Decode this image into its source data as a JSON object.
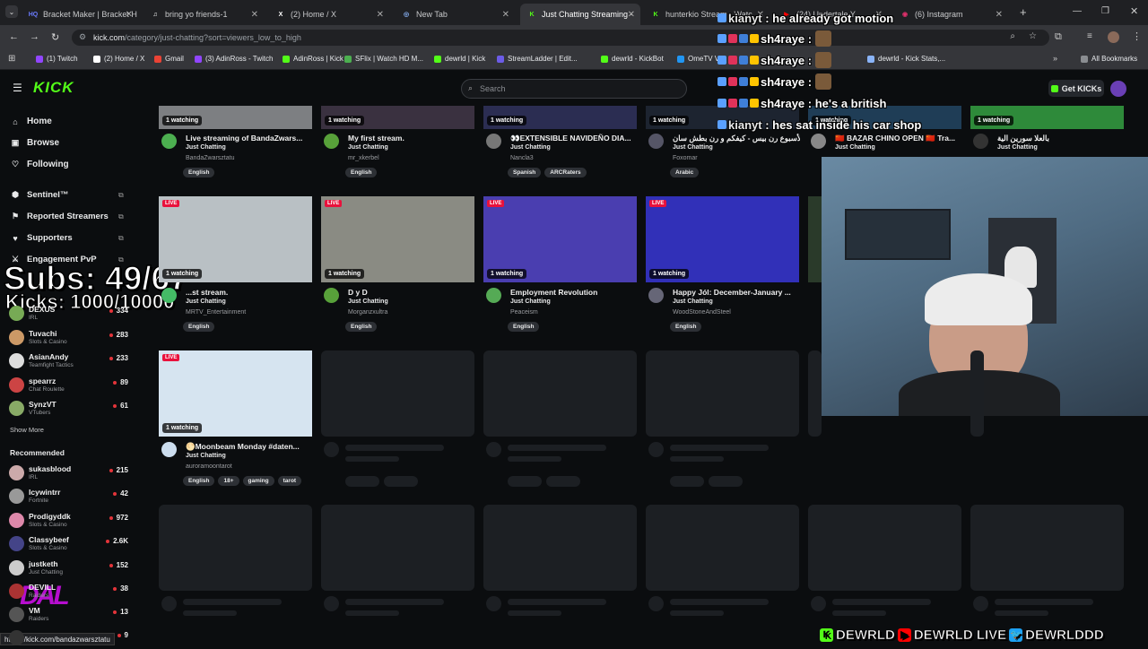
{
  "browser": {
    "tabs": [
      {
        "label": "Bracket Maker | Bracket H",
        "icon": "HQ",
        "color": "#6b7bff"
      },
      {
        "label": "bring yo friends-1",
        "icon": "♫",
        "color": "#ffffff"
      },
      {
        "label": "(2) Home / X",
        "icon": "X",
        "color": "#ffffff"
      },
      {
        "label": "New Tab",
        "icon": "◎",
        "color": "#8ab4f8"
      },
      {
        "label": "Just Chatting Streaming -",
        "icon": "K",
        "color": "#53fc18"
      },
      {
        "label": "hunterkio Stream - Watc",
        "icon": "K",
        "color": "#53fc18"
      },
      {
        "label": "(24) Undertale Y",
        "icon": "▶",
        "color": "#ff0000"
      },
      {
        "label": "(6) Instagram",
        "icon": "◉",
        "color": "#e1306c"
      }
    ],
    "url_host": "kick.com",
    "url_path": "/category/just-chatting?sort=viewers_low_to_high",
    "bookmarks": [
      {
        "label": "(1) Twitch",
        "color": "#9146ff"
      },
      {
        "label": "(2) Home / X",
        "color": "#ffffff"
      },
      {
        "label": "Gmail",
        "color": "#ea4335"
      },
      {
        "label": "(3) AdinRoss - Twitch",
        "color": "#9146ff"
      },
      {
        "label": "AdinRoss | Kick",
        "color": "#53fc18"
      },
      {
        "label": "SFlix | Watch HD M...",
        "color": "#4caf50"
      },
      {
        "label": "dewrld | Kick",
        "color": "#53fc18"
      },
      {
        "label": "StreamLadder | Edit...",
        "color": "#6c5ce7"
      },
      {
        "label": "dewrld - KickBot",
        "color": "#53fc18"
      },
      {
        "label": "OmeTV Vi...",
        "color": "#2196f3"
      },
      {
        "label": "dewrld - Kick Stats,...",
        "color": "#8ab4f8"
      }
    ],
    "all_bookmarks": "All Bookmarks",
    "status_url": "https://kick.com/bandazwarsztatu"
  },
  "kick": {
    "logo": "KICK",
    "search_placeholder": "Search",
    "get_kicks": "Get KICKs",
    "nav": [
      {
        "label": "Home",
        "icon": "⌂"
      },
      {
        "label": "Browse",
        "icon": "▣"
      },
      {
        "label": "Following",
        "icon": "♡"
      }
    ],
    "ext_nav": [
      {
        "label": "Sentinel™",
        "icon": "⬢"
      },
      {
        "label": "Reported Streamers",
        "icon": "⚑"
      },
      {
        "label": "Supporters",
        "icon": "♥"
      },
      {
        "label": "Engagement PvP",
        "icon": "⚔"
      }
    ],
    "following": [
      {
        "name": "DEXUS",
        "cat": "IRL",
        "viewers": "334",
        "color": "#7a5"
      },
      {
        "name": "Tuvachi",
        "cat": "Slots & Casino",
        "viewers": "283",
        "color": "#c96"
      },
      {
        "name": "AsianAndy",
        "cat": "Teamfight Tactics",
        "viewers": "233",
        "color": "#ddd"
      },
      {
        "name": "spearrz",
        "cat": "Chat Roulette",
        "viewers": "89",
        "color": "#c44"
      },
      {
        "name": "SynzVT",
        "cat": "VTubers",
        "viewers": "61",
        "color": "#8a6"
      }
    ],
    "show_more": "Show More",
    "recommended_title": "Recommended",
    "recommended": [
      {
        "name": "sukasblood",
        "cat": "IRL",
        "viewers": "215",
        "color": "#caa"
      },
      {
        "name": "Icywintrr",
        "cat": "Fortnite",
        "viewers": "42",
        "color": "#999"
      },
      {
        "name": "Prodigyddk",
        "cat": "Slots & Casino",
        "viewers": "972",
        "color": "#d8a"
      },
      {
        "name": "Classybeef",
        "cat": "Slots & Casino",
        "viewers": "2.6K",
        "color": "#448"
      },
      {
        "name": "justketh",
        "cat": "Just Chatting",
        "viewers": "152",
        "color": "#ccc"
      },
      {
        "name": "DEVILL",
        "cat": "Raiders",
        "viewers": "38",
        "color": "#a33"
      },
      {
        "name": "VM",
        "cat": "Raiders",
        "viewers": "13",
        "color": "#555"
      },
      {
        "name": "",
        "cat": "",
        "viewers": "9",
        "color": "#333"
      }
    ],
    "row1": [
      {
        "watching": "1 watching",
        "title": "Live streaming of BandaZwars...",
        "cat": "Just Chatting",
        "user": "BandaZwarsztatu",
        "tags": [
          "English"
        ],
        "thumb": "#7d7f82",
        "av": "#4caf50"
      },
      {
        "watching": "1 watching",
        "title": "My first stream.",
        "cat": "Just Chatting",
        "user": "mr_xkerbel",
        "tags": [
          "English"
        ],
        "thumb": "#3a3140",
        "av": "#58a13a"
      },
      {
        "watching": "1 watching",
        "title": "👀EXTENSIBLE NAVIDEÑO DIA...",
        "cat": "Just Chatting",
        "user": "Nancla3",
        "tags": [
          "Spanish",
          "ARCRaters"
        ],
        "thumb": "#2b2d52",
        "av": "#777"
      },
      {
        "watching": "1 watching",
        "title": "ت الأسبوع رن بيس - كيفكم و رن بطش سان",
        "cat": "Just Chatting",
        "user": "Foxomar",
        "tags": [
          "Arabic"
        ],
        "thumb": "#1d2430",
        "av": "#556"
      },
      {
        "watching": "1 watching",
        "title": "🇨🇳 BAZAR CHINO OPEN 🇨🇳 Tra...",
        "cat": "Just Chatting",
        "user": "",
        "tags": [],
        "thumb": "#1f3d56",
        "av": "#888"
      },
      {
        "watching": "1 watching",
        "title": "بالعلا سورين الية",
        "cat": "Just Chatting",
        "user": "",
        "tags": [],
        "thumb": "#2e8a3a",
        "av": "#333"
      }
    ],
    "row2": [
      {
        "watching": "1 watching",
        "title": "...st stream.",
        "cat": "Just Chatting",
        "user": "MRTV_Entertainment",
        "tags": [
          "English"
        ],
        "thumb": "#b9c0c4",
        "av": "#4b6"
      },
      {
        "watching": "1 watching",
        "title": "D y D",
        "cat": "Just Chatting",
        "user": "Morganzxultra",
        "tags": [
          "English"
        ],
        "thumb": "#8a8b83",
        "av": "#58a13a"
      },
      {
        "watching": "1 watching",
        "title": "Employment Revolution",
        "cat": "Just Chatting",
        "user": "Peaceism",
        "tags": [
          "English"
        ],
        "thumb": "#4a3eb0",
        "av": "#5a5"
      },
      {
        "watching": "1 watching",
        "title": "Happy Jól: December-January ...",
        "cat": "Just Chatting",
        "user": "WoodStoneAndSteel",
        "tags": [
          "English"
        ],
        "thumb": "#3130b8",
        "av": "#667"
      }
    ],
    "row3": [
      {
        "watching": "1 watching",
        "title": "🌕Moonbeam Monday #daten...",
        "cat": "Just Chatting",
        "user": "auroramoontarot",
        "tags": [
          "English",
          "18+",
          "gaming",
          "tarot"
        ],
        "thumb": "#d6e4f0",
        "av": "#cde"
      }
    ],
    "live_label": "LIVE"
  },
  "overlay": {
    "subs": "Subs: 49/67",
    "kicks": "Kicks: 1000/10000",
    "chat": [
      {
        "user": "kianyt",
        "msg": "he already got motion"
      },
      {
        "user": "sh4raye",
        "msg": ""
      },
      {
        "user": "sh4raye",
        "msg": ""
      },
      {
        "user": "sh4raye",
        "msg": ""
      },
      {
        "user": "sh4raye",
        "msg": "he's a british"
      },
      {
        "user": "kianyt",
        "msg": "hes sat inside his car shop"
      }
    ],
    "socials": [
      "DEWRLD",
      "DEWRLD LIVE",
      "DEWRLDDD"
    ],
    "social_icons": [
      "K",
      "▶",
      "🐦"
    ]
  }
}
